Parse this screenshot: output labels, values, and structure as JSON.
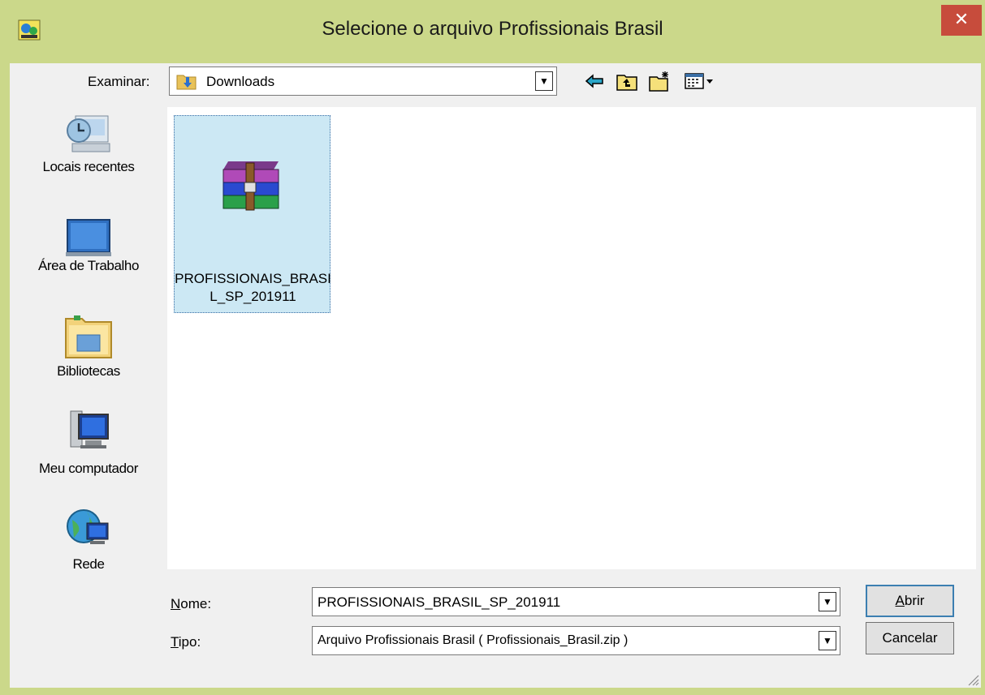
{
  "window": {
    "title": "Selecione o arquivo Profissionais Brasil",
    "close_glyph": "✕",
    "frame_color": "#cbd88a",
    "close_color": "#c74c3c",
    "app_icon": "app-icon"
  },
  "lookin": {
    "label": "Examinar:",
    "value": "Downloads",
    "icon": "downloads-folder-icon"
  },
  "toolbar": {
    "back_icon": "back-arrow-icon",
    "up_icon": "up-folder-icon",
    "new_folder_icon": "new-folder-icon",
    "view_menu_icon": "view-menu-icon"
  },
  "places": [
    {
      "label": "Locais recentes",
      "icon": "recent-places-icon"
    },
    {
      "label": "Área de Trabalho",
      "icon": "desktop-icon"
    },
    {
      "label": "Bibliotecas",
      "icon": "libraries-icon"
    },
    {
      "label": "Meu computador",
      "icon": "computer-icon"
    },
    {
      "label": "Rede",
      "icon": "network-icon"
    }
  ],
  "files": [
    {
      "name": "PROFISSIONAIS_BRASIL_SP_201911",
      "icon": "winrar-archive-icon",
      "selected": true
    }
  ],
  "filename": {
    "label": "Nome:",
    "value": "PROFISSIONAIS_BRASIL_SP_201911"
  },
  "filetype": {
    "label": "Tipo:",
    "value": "Arquivo Profissionais Brasil ( Profissionais_Brasil.zip )"
  },
  "buttons": {
    "open": "Abrir",
    "cancel": "Cancelar"
  }
}
